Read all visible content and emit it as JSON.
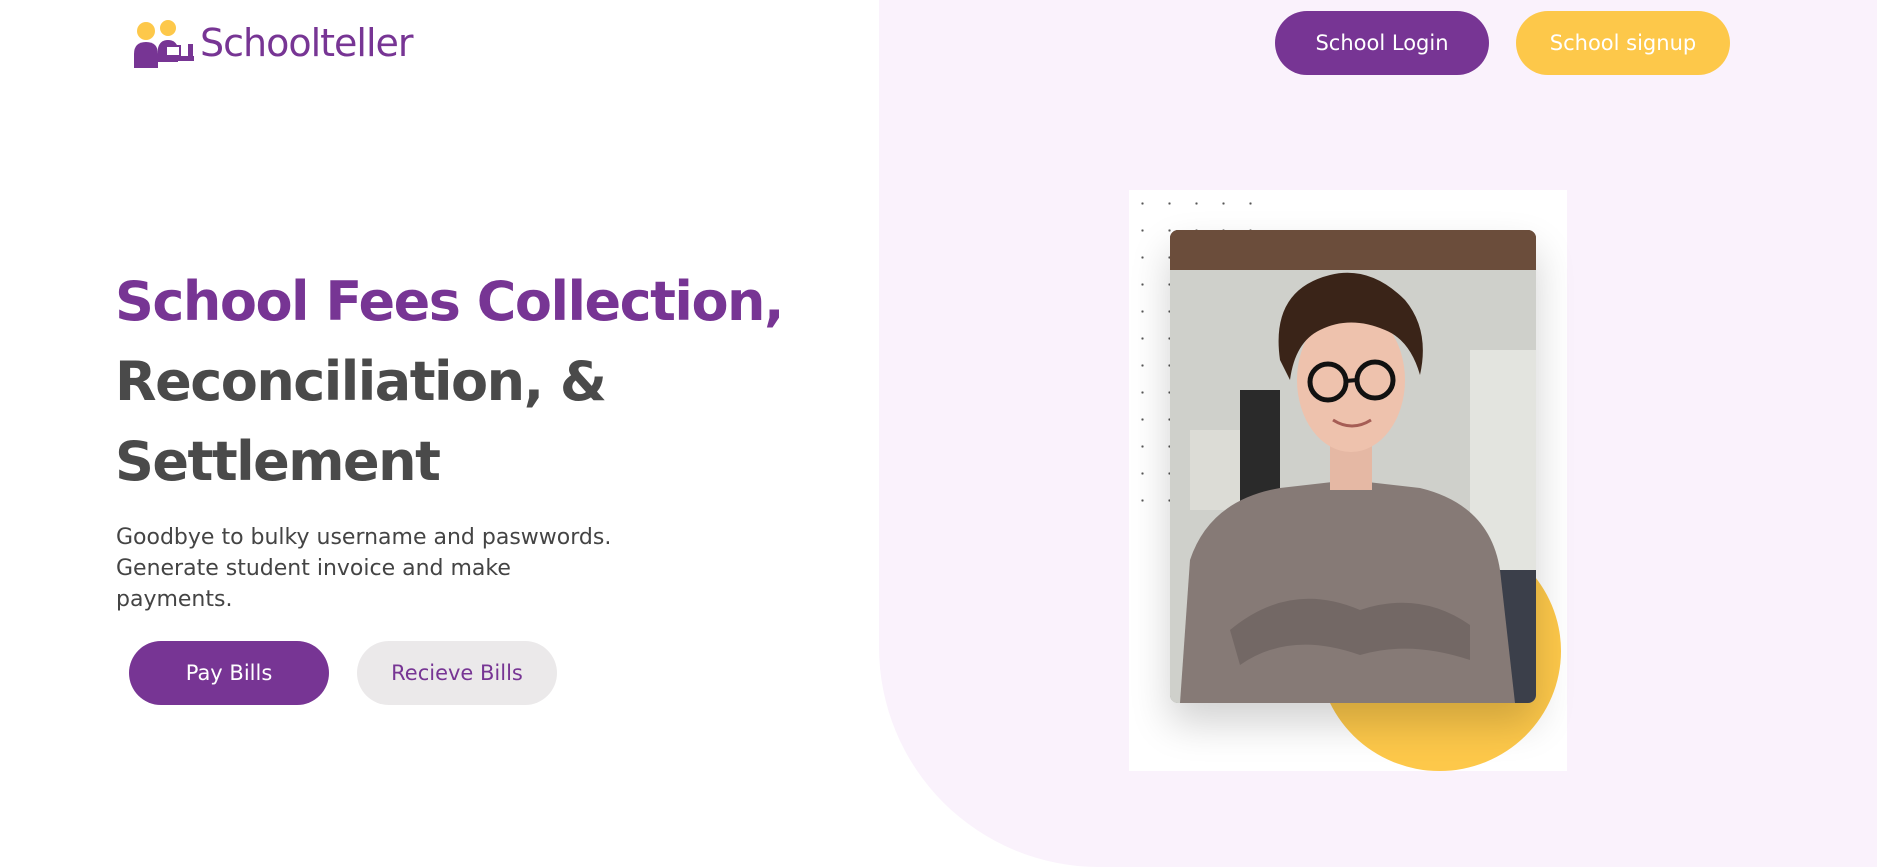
{
  "brand": {
    "name": "Schoolteller",
    "color": "#773594",
    "accent": "#fdc84a"
  },
  "header": {
    "login_label": "School Login",
    "signup_label": "School signup"
  },
  "hero": {
    "title_accent": "School Fees Collection,",
    "title_line2": "Reconciliation, &",
    "title_line3": "Settlement",
    "subtitle": "Goodbye to bulky username and paswwords. Generate student invoice and make payments.",
    "pay_label": "Pay Bills",
    "receive_label": "Recieve Bills"
  },
  "image": {
    "subject": "smiling woman with glasses, arms crossed"
  }
}
